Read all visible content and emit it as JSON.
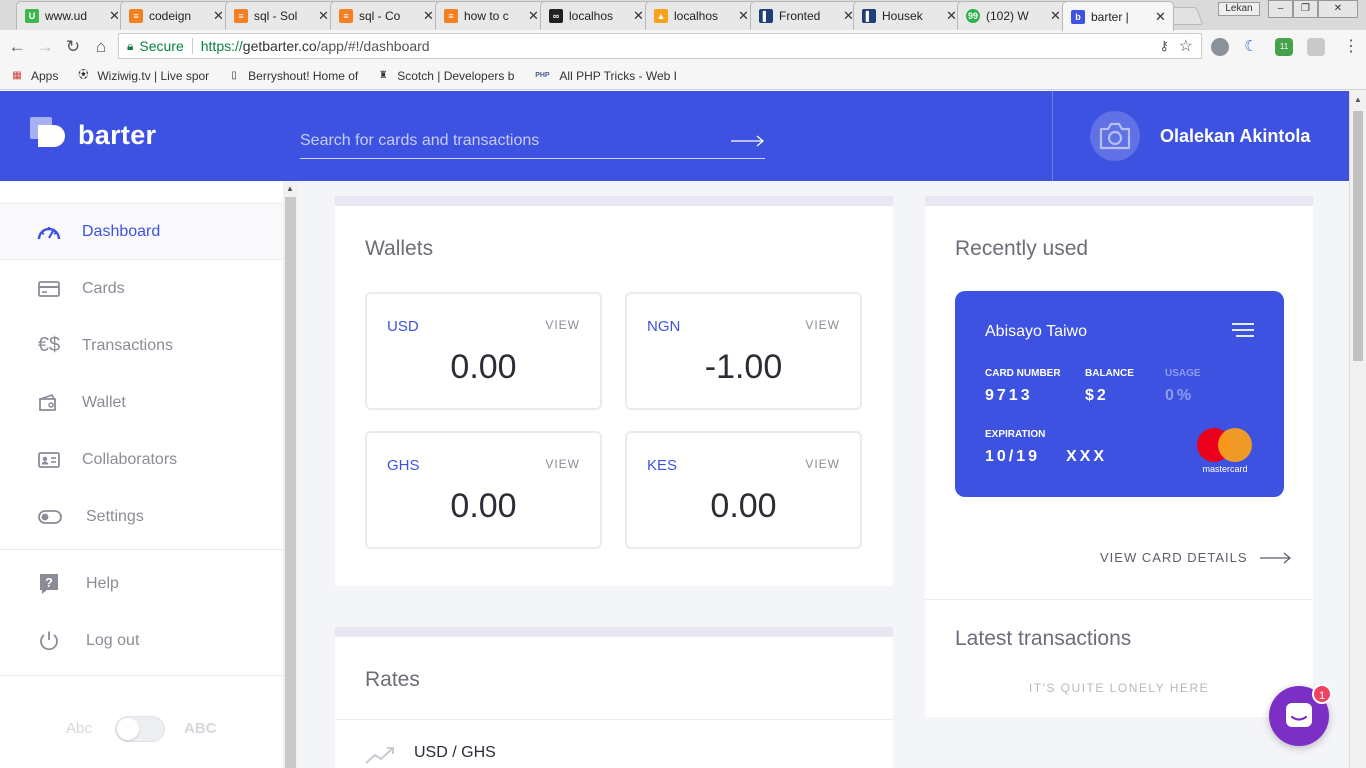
{
  "browser": {
    "tabs": [
      {
        "title": "www.ud",
        "favicon_color": "#3fb649",
        "favicon_glyph": "U"
      },
      {
        "title": "codeign",
        "favicon_color": "#f48024",
        "favicon_glyph": "≡"
      },
      {
        "title": "sql - Sol",
        "favicon_color": "#f48024",
        "favicon_glyph": "≡"
      },
      {
        "title": "sql - Co",
        "favicon_color": "#f48024",
        "favicon_glyph": "≡"
      },
      {
        "title": "how to c",
        "favicon_color": "#f48024",
        "favicon_glyph": "≡"
      },
      {
        "title": "localhos",
        "favicon_color": "#222222",
        "favicon_glyph": "∞"
      },
      {
        "title": "localhos",
        "favicon_color": "#f7a21b",
        "favicon_glyph": "▲"
      },
      {
        "title": "Fronted",
        "favicon_color": "#1f3f7a",
        "favicon_glyph": "▌"
      },
      {
        "title": "Housek",
        "favicon_color": "#1f3f7a",
        "favicon_glyph": "▌"
      },
      {
        "title": "(102) W",
        "favicon_color": "#2bb24c",
        "favicon_glyph": "99"
      },
      {
        "title": "barter |",
        "favicon_color": "#3d52e0",
        "favicon_glyph": "b"
      }
    ],
    "active_tab_index": 10,
    "window_user": "Lekan",
    "secure_label": "Secure",
    "url_scheme": "https://",
    "url_host": "getbarter.co",
    "url_path": "/app/#!/dashboard",
    "ext_badge": "11",
    "bookmarks": [
      {
        "label": "Apps",
        "icon": "apps-grid-icon"
      },
      {
        "label": "Wiziwig.tv | Live spor",
        "icon": "football-icon"
      },
      {
        "label": "Berryshout! Home of",
        "icon": "page-icon"
      },
      {
        "label": "Scotch | Developers b",
        "icon": "scotch-icon"
      },
      {
        "label": "All PHP Tricks - Web I",
        "icon": "php-icon"
      }
    ]
  },
  "app": {
    "brand": "barter",
    "brand_color": "#3d52e0",
    "search_placeholder": "Search for cards and transactions",
    "user_name": "Olalekan Akintola"
  },
  "sidebar": {
    "items": [
      {
        "label": "Dashboard",
        "icon": "dashboard-gauge-icon",
        "active": true
      },
      {
        "label": "Cards",
        "icon": "card-icon"
      },
      {
        "label": "Transactions",
        "icon": "currency-exchange-icon"
      },
      {
        "label": "Wallet",
        "icon": "wallet-icon"
      },
      {
        "label": "Collaborators",
        "icon": "contact-card-icon"
      },
      {
        "label": "Settings",
        "icon": "toggle-icon"
      },
      {
        "label": "Help",
        "icon": "help-icon"
      },
      {
        "label": "Log out",
        "icon": "power-icon"
      }
    ],
    "theme_small": "Abc",
    "theme_large": "ABC"
  },
  "wallets": {
    "title": "Wallets",
    "view_label": "VIEW",
    "items": [
      {
        "currency": "USD",
        "amount": "0.00"
      },
      {
        "currency": "NGN",
        "amount": "-1.00"
      },
      {
        "currency": "GHS",
        "amount": "0.00"
      },
      {
        "currency": "KES",
        "amount": "0.00"
      }
    ]
  },
  "rates": {
    "title": "Rates",
    "first_pair": "USD / GHS"
  },
  "recently_used": {
    "title": "Recently used",
    "card": {
      "holder": "Abisayo Taiwo",
      "card_number_label": "CARD NUMBER",
      "card_number": "9713",
      "balance_label": "BALANCE",
      "balance": "$2",
      "usage_label": "USAGE",
      "usage": "0%",
      "expiration_label": "EXPIRATION",
      "expiration": "10/19",
      "cvv": "XXX",
      "network": "mastercard"
    },
    "view_details": "VIEW CARD DETAILS"
  },
  "latest_transactions": {
    "title": "Latest transactions",
    "empty_text": "IT'S QUITE LONELY HERE"
  },
  "chat": {
    "badge": "1"
  }
}
